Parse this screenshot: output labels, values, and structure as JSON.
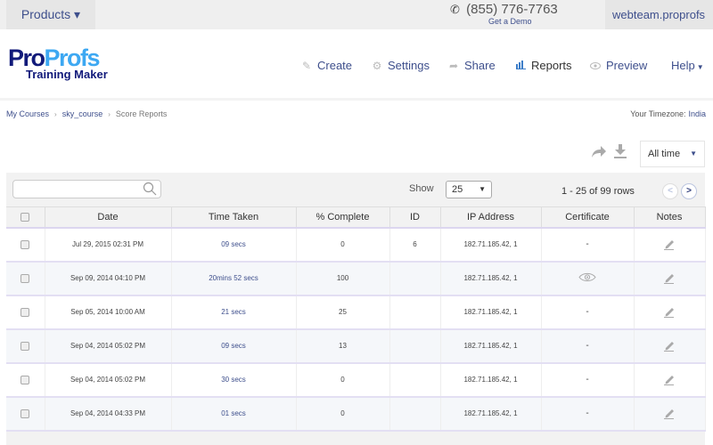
{
  "topbar": {
    "products_label": "Products ▾",
    "phone_icon": "phone-icon",
    "phone": "(855) 776-7763",
    "demo_link": "Get a Demo",
    "account": "webteam.proprofs"
  },
  "logo": {
    "part1": "Pro",
    "part2": "Profs",
    "subtitle": "Training Maker"
  },
  "nav": [
    {
      "label": "Create",
      "icon": "pencil-icon"
    },
    {
      "label": "Settings",
      "icon": "gear-icon"
    },
    {
      "label": "Share",
      "icon": "share-icon"
    },
    {
      "label": "Reports",
      "icon": "bar-chart-icon",
      "active": true
    },
    {
      "label": "Preview",
      "icon": "eye-icon"
    },
    {
      "label": "Help",
      "icon": "caret-down-icon"
    }
  ],
  "breadcrumb": [
    "My Courses",
    "sky_course",
    "Score Reports"
  ],
  "timezone": {
    "label": "Your Timezone:",
    "value": "India"
  },
  "filters": {
    "time_range": "All time"
  },
  "table_controls": {
    "search_placeholder": "",
    "show_label": "Show",
    "page_size": "25",
    "rows_info": "1 - 25 of 99 rows"
  },
  "columns": [
    "Date",
    "Time Taken",
    "% Complete",
    "ID",
    "IP Address",
    "Certificate",
    "Notes"
  ],
  "rows": [
    {
      "date": "Jul 29, 2015 02:31 PM",
      "time": "09 secs",
      "complete": "0",
      "id": "6",
      "ip": "182.71.185.42, 1",
      "certificate": "-"
    },
    {
      "date": "Sep 09, 2014 04:10 PM",
      "time": "20mins 52 secs",
      "complete": "100",
      "id": "",
      "ip": "182.71.185.42, 1",
      "certificate": "eye-icon"
    },
    {
      "date": "Sep 05, 2014 10:00 AM",
      "time": "21 secs",
      "complete": "25",
      "id": "",
      "ip": "182.71.185.42, 1",
      "certificate": "-"
    },
    {
      "date": "Sep 04, 2014 05:02 PM",
      "time": "09 secs",
      "complete": "13",
      "id": "",
      "ip": "182.71.185.42, 1",
      "certificate": "-"
    },
    {
      "date": "Sep 04, 2014 05:02 PM",
      "time": "30 secs",
      "complete": "0",
      "id": "",
      "ip": "182.71.185.42, 1",
      "certificate": "-"
    },
    {
      "date": "Sep 04, 2014 04:33 PM",
      "time": "01 secs",
      "complete": "0",
      "id": "",
      "ip": "182.71.185.42, 1",
      "certificate": "-"
    }
  ]
}
